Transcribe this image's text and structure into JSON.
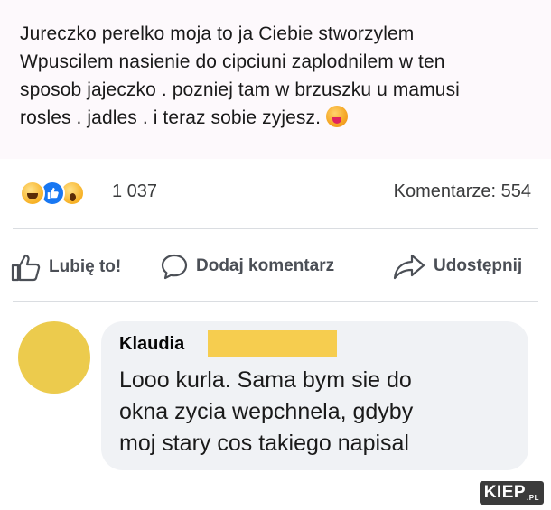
{
  "post": {
    "lines": [
      "Jureczko perelko moja to ja Ciebie stworzylem",
      "Wpuscilem nasienie do cipciuni zaplodnilem w ten",
      "sposob jajeczko . pozniej tam w brzuszku u mamusi",
      "rosles . jadles . i teraz sobie zyjesz."
    ],
    "trailing_emoji": "squinting-face-with-tongue-emoji"
  },
  "reactions": {
    "icons": [
      "haha-reaction-icon",
      "like-reaction-icon",
      "wow-reaction-icon"
    ],
    "count": "1 037",
    "comments": "Komentarze: 554"
  },
  "actions": {
    "like": "Lubię to!",
    "comment": "Dodaj komentarz",
    "share": "Udostępnij"
  },
  "comment": {
    "author": "Klaudia",
    "lines": [
      "Looo kurla. Sama bym sie do",
      "okna zycia wepchnela, gdyby",
      "moj stary cos takiego napisal"
    ]
  },
  "watermark": {
    "text": "KIEP",
    "suffix": ".PL"
  },
  "colors": {
    "post_background": "#fdf9fc",
    "comment_bubble": "#f0f2f5",
    "redaction": "#f6cd4f",
    "avatar": "#eccb4d",
    "like_blue": "#1877f2"
  }
}
